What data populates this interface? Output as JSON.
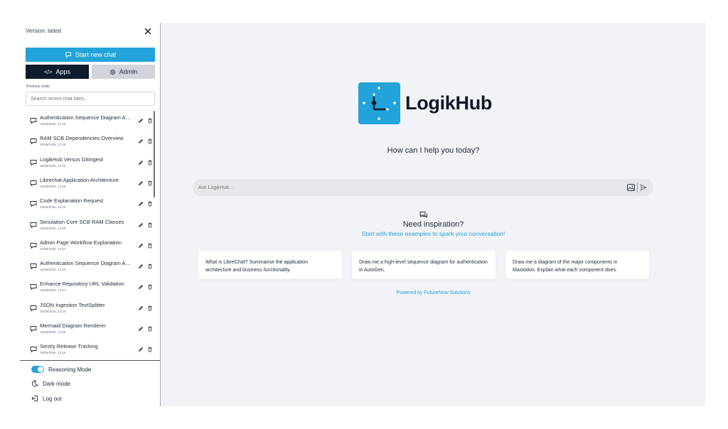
{
  "sidebar": {
    "version": "Version: latest",
    "new_chat_label": "Start new chat",
    "tabs": [
      {
        "label": "Apps",
        "icon": "code-icon"
      },
      {
        "label": "Admin",
        "icon": "gear-icon"
      }
    ],
    "previous_chats_label": "Previous chats",
    "search_placeholder": "Search recent chat titles...",
    "chats": [
      {
        "title": "Authentication Sequence Diagram Au...",
        "date": "10/06/2025, 17:43"
      },
      {
        "title": "RAM SCB Dependencies Overview",
        "date": "10/06/2025, 17:09"
      },
      {
        "title": "LogikHub Versus GitIngest",
        "date": "10/06/2025, 17:02"
      },
      {
        "title": "Librechat Application Architecture",
        "date": "10/06/2025, 14:48"
      },
      {
        "title": "Code Explanation Request",
        "date": "10/06/2025, 14:43"
      },
      {
        "title": "Simulation Core SCB RAM Classes",
        "date": "10/06/2025, 14:40"
      },
      {
        "title": "Admin Page Workflow Explanation",
        "date": "10/06/2025, 14:37"
      },
      {
        "title": "Authentication Sequence Diagram Au...",
        "date": "10/06/2025, 14:33"
      },
      {
        "title": "Enhance Repository URL Validation",
        "date": "10/06/2025, 14:27"
      },
      {
        "title": "JSON Ingestion TextSplitter",
        "date": "10/06/2025, 14:26"
      },
      {
        "title": "Mermaid Diagram Renderer",
        "date": "10/06/2025, 14:25"
      },
      {
        "title": "Sentry Release Tracking",
        "date": "10/06/2025, 14:25"
      }
    ],
    "bottom": {
      "reasoning_label": "Reasoning Mode",
      "reasoning_on": true,
      "dark_mode_label": "Dark mode",
      "logout_label": "Log out"
    }
  },
  "main": {
    "brand": "LogikHub",
    "greeting": "How can I help you today?",
    "ask_placeholder": "Ask LogikHub...",
    "inspiration_title": "Need inspiration?",
    "inspiration_subtitle": "Start with these examples to spark your conversation!",
    "examples": [
      "What is LibreChat? Summarise the application architecture and business functionality.",
      "Draw me a high-level sequence diagram for authentication in AutoGen.",
      "Draw me a diagram of the major components in Mastodon. Explain what each component does."
    ],
    "powered_by": "Powered by FutureNow Solutions"
  },
  "colors": {
    "accent": "#22a3da",
    "dark_tab": "#0e1b2c",
    "main_bg": "#f2f3f7"
  }
}
